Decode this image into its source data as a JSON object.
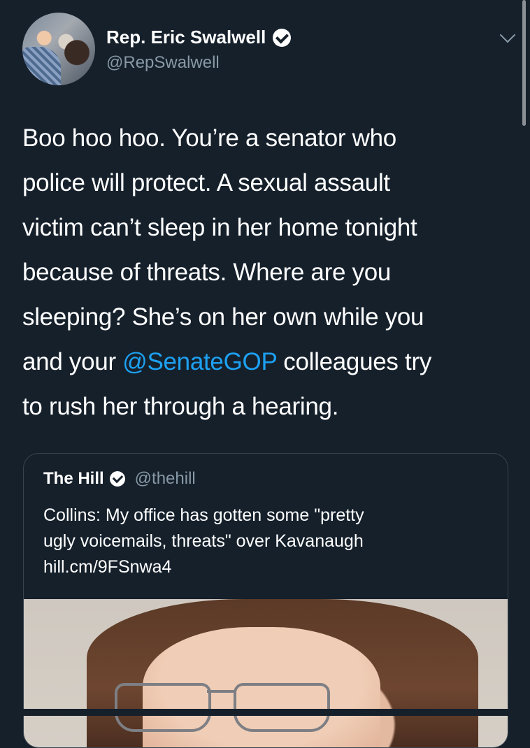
{
  "tweet": {
    "author_name": "Rep. Eric Swalwell",
    "author_handle": "@RepSwalwell",
    "text_lines": [
      "Boo hoo hoo. You’re a senator who",
      "police will protect. A sexual assault",
      "victim can’t sleep in her home tonight",
      "because of threats. Where are you",
      "sleeping? She’s on her own while you"
    ],
    "line6_pre": "and your ",
    "mention": "@SenateGOP",
    "line6_post": " colleagues try",
    "line7": "to rush her through a hearing."
  },
  "quote": {
    "author_name": "The Hill",
    "author_handle": "@thehill",
    "text_lines": [
      "Collins: My office has gotten some \"pretty",
      "ugly voicemails, threats\" over Kavanaugh",
      "hill.cm/9FSnwa4"
    ]
  },
  "icons": {
    "verified": "verified-badge-icon",
    "chevron": "chevron-down-icon"
  },
  "colors": {
    "background": "#15202b",
    "mention": "#1da1f2",
    "secondary_text": "#8899a6"
  }
}
